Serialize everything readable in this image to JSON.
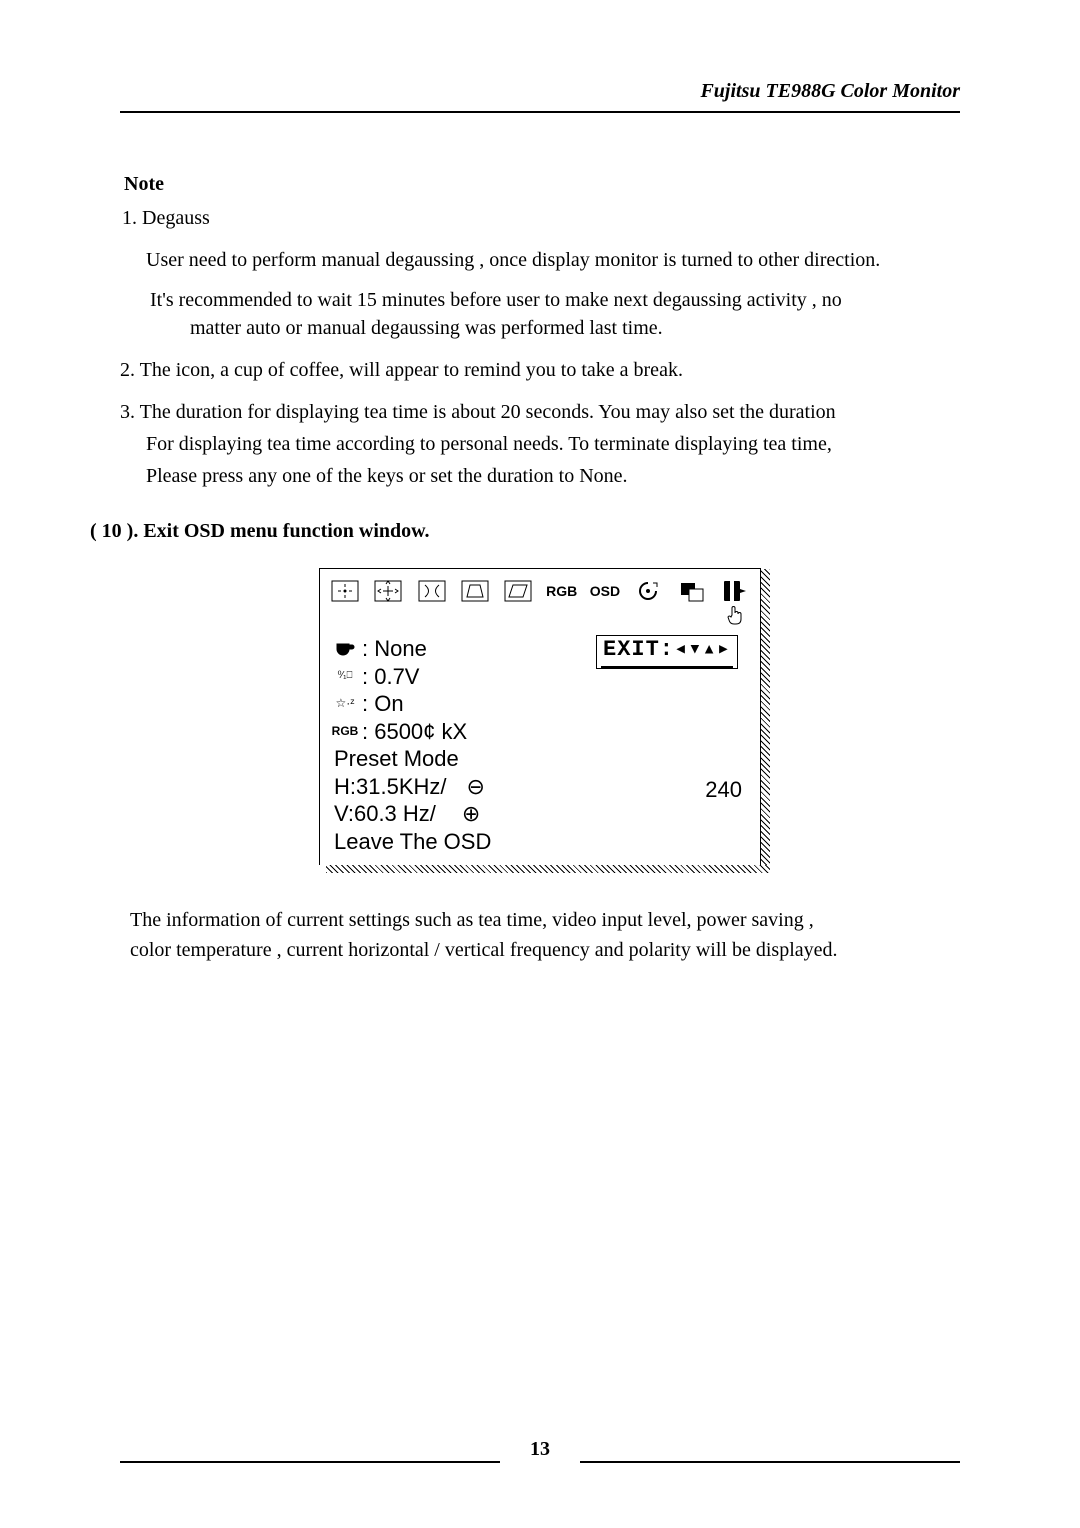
{
  "header": {
    "title": "Fujitsu TE988G Color Monitor"
  },
  "notes": {
    "heading": "Note",
    "item1_label": "1. Degauss",
    "item1_sub1": "User need to perform manual degaussing , once display monitor is turned to other direction.",
    "item1_sub2a": "It's recommended to wait 15 minutes before user to make next degaussing activity , no",
    "item1_sub2b": "matter auto or manual degaussing was performed last time.",
    "item2": "2. The icon, a cup of coffee, will appear to remind you to take a break.",
    "item3a": "3. The duration for displaying tea time is about 20 seconds. You may also set the duration",
    "item3b": "For displaying tea time according to personal needs. To terminate displaying tea time,",
    "item3c": "Please press any one of the keys or set the duration to None."
  },
  "section": {
    "title": "( 10 ). Exit OSD menu function window."
  },
  "osd": {
    "icon_row": {
      "rgb": "RGB",
      "osd": "OSD"
    },
    "hand": "☞",
    "left": {
      "cup_value": ": None",
      "video_value": ": 0.7V",
      "power_value": ": On",
      "rgb_label": "RGB",
      "rgb_value": ": 6500¢ kX",
      "preset": "Preset Mode",
      "hfreq": "H:31.5KHz/",
      "vfreq": "V:60.3 Hz/",
      "leave": "Leave The OSD"
    },
    "right": {
      "exit": "EXIT:",
      "arrows": "◂▾▴▸",
      "num": "240"
    }
  },
  "para": {
    "l1": "The information of current settings such as tea time, video input level, power saving ,",
    "l2": "color temperature , current horizontal / vertical frequency and polarity will be displayed."
  },
  "page_number": "13"
}
